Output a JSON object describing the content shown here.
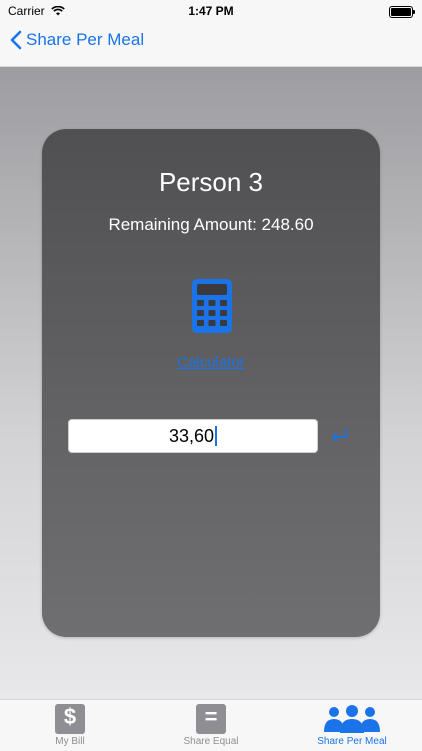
{
  "status_bar": {
    "carrier": "Carrier",
    "time": "1:47 PM"
  },
  "nav": {
    "back_label": "Share Per Meal"
  },
  "card": {
    "person_title": "Person 3",
    "remaining_label": "Remaining Amount:",
    "remaining_value": "248.60",
    "calculator_link": "Calculator",
    "amount_value": "33,60"
  },
  "tabs": [
    {
      "label": "My Bill",
      "icon": "dollar-icon",
      "glyph": "$"
    },
    {
      "label": "Share Equal",
      "icon": "equals-icon",
      "glyph": "="
    },
    {
      "label": "Share Per Meal",
      "icon": "people-icon"
    }
  ],
  "colors": {
    "accent": "#1a73e8",
    "card": "#5a5a5c",
    "inactive_tab": "#8e8e93"
  }
}
